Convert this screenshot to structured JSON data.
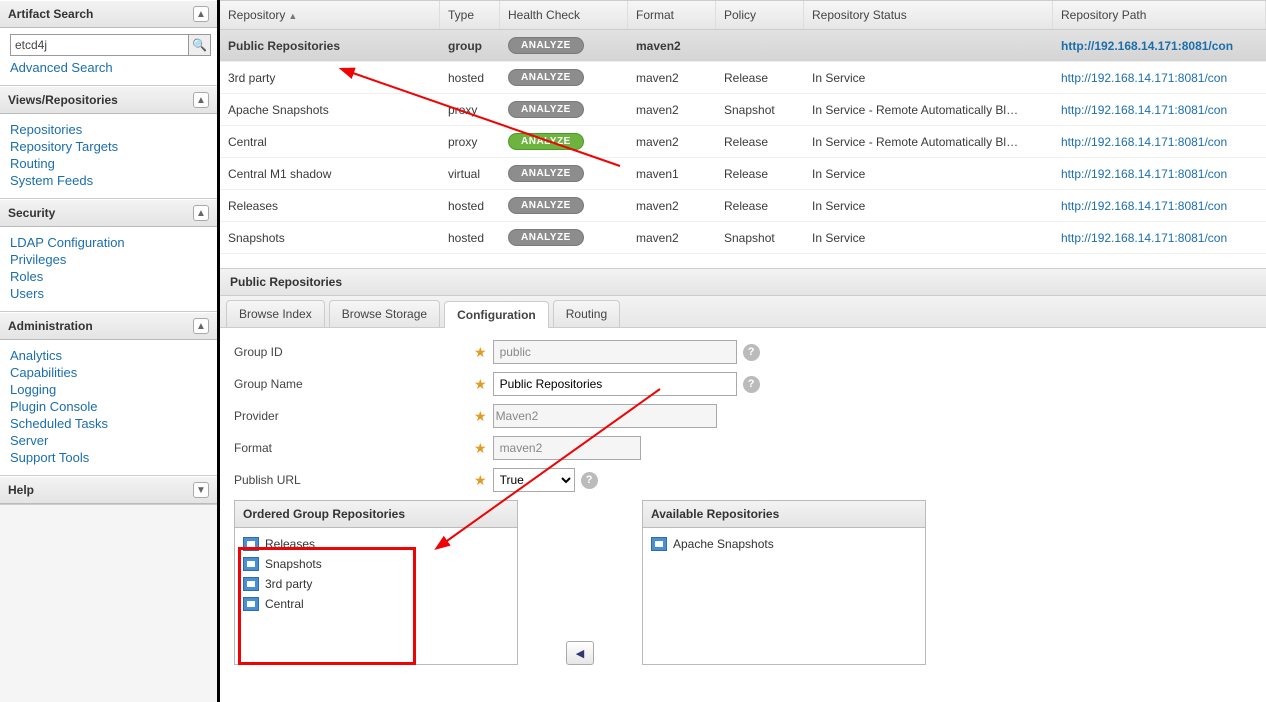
{
  "sidebar": {
    "panels": {
      "search": {
        "title": "Artifact Search",
        "value": "etcd4j",
        "advanced": "Advanced Search"
      },
      "views": {
        "title": "Views/Repositories",
        "items": [
          "Repositories",
          "Repository Targets",
          "Routing",
          "System Feeds"
        ]
      },
      "security": {
        "title": "Security",
        "items": [
          "LDAP Configuration",
          "Privileges",
          "Roles",
          "Users"
        ]
      },
      "admin": {
        "title": "Administration",
        "items": [
          "Analytics",
          "Capabilities",
          "Logging",
          "Plugin Console",
          "Scheduled Tasks",
          "Server",
          "Support Tools"
        ]
      },
      "help": {
        "title": "Help"
      }
    }
  },
  "grid": {
    "headers": {
      "repo": "Repository",
      "type": "Type",
      "health": "Health Check",
      "format": "Format",
      "policy": "Policy",
      "status": "Repository Status",
      "path": "Repository Path"
    },
    "analyze_label": "ANALYZE",
    "rows": [
      {
        "repo": "Public Repositories",
        "type": "group",
        "green": false,
        "format": "maven2",
        "policy": "",
        "status": "",
        "path": "http://192.168.14.171:8081/con",
        "selected": true
      },
      {
        "repo": "3rd party",
        "type": "hosted",
        "green": false,
        "format": "maven2",
        "policy": "Release",
        "status": "In Service",
        "path": "http://192.168.14.171:8081/con"
      },
      {
        "repo": "Apache Snapshots",
        "type": "proxy",
        "green": false,
        "format": "maven2",
        "policy": "Snapshot",
        "status": "In Service - Remote Automatically Bl…",
        "path": "http://192.168.14.171:8081/con"
      },
      {
        "repo": "Central",
        "type": "proxy",
        "green": true,
        "format": "maven2",
        "policy": "Release",
        "status": "In Service - Remote Automatically Bl…",
        "path": "http://192.168.14.171:8081/con"
      },
      {
        "repo": "Central M1 shadow",
        "type": "virtual",
        "green": false,
        "format": "maven1",
        "policy": "Release",
        "status": "In Service",
        "path": "http://192.168.14.171:8081/con"
      },
      {
        "repo": "Releases",
        "type": "hosted",
        "green": false,
        "format": "maven2",
        "policy": "Release",
        "status": "In Service",
        "path": "http://192.168.14.171:8081/con"
      },
      {
        "repo": "Snapshots",
        "type": "hosted",
        "green": false,
        "format": "maven2",
        "policy": "Snapshot",
        "status": "In Service",
        "path": "http://192.168.14.171:8081/con"
      }
    ]
  },
  "detail": {
    "title": "Public Repositories",
    "tabs": {
      "browse_index": "Browse Index",
      "browse_storage": "Browse Storage",
      "configuration": "Configuration",
      "routing": "Routing"
    },
    "form": {
      "group_id": {
        "label": "Group ID",
        "value": "public"
      },
      "group_name": {
        "label": "Group Name",
        "value": "Public Repositories"
      },
      "provider": {
        "label": "Provider",
        "value": "Maven2"
      },
      "format": {
        "label": "Format",
        "value": "maven2"
      },
      "publish": {
        "label": "Publish URL",
        "value": "True"
      }
    },
    "ordered": {
      "title": "Ordered Group Repositories",
      "items": [
        "Releases",
        "Snapshots",
        "3rd party",
        "Central"
      ]
    },
    "available": {
      "title": "Available Repositories",
      "items": [
        "Apache Snapshots"
      ]
    }
  }
}
